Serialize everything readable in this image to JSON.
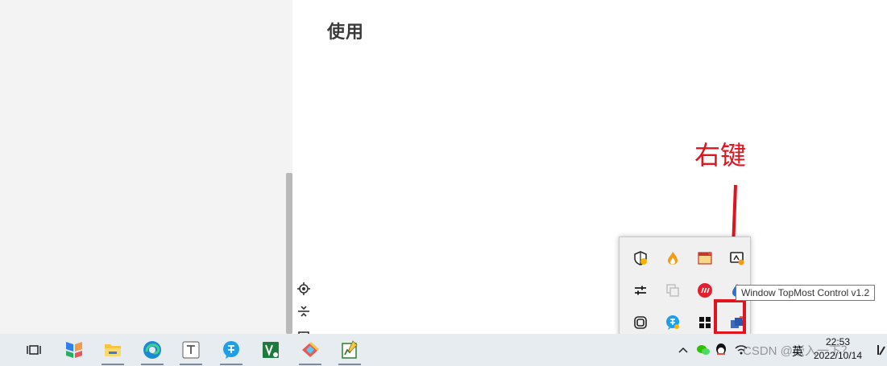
{
  "page": {
    "title": "使用"
  },
  "annotation": {
    "text": "右键",
    "color": "#e0141e"
  },
  "tooltip": {
    "text": "Window TopMost Control v1.2"
  },
  "tray_popup": {
    "icons": [
      "shield-warning-icon",
      "flame-app-icon",
      "window-app-icon",
      "display-app-icon",
      "sliders-icon",
      "copy-app-icon",
      "red-circle-app-icon",
      "blue-drop-app-icon",
      "mesh-app-icon",
      "translate-app-icon",
      "black-squares-app-icon",
      "topmost-control-icon"
    ]
  },
  "taskbar": {
    "apps": [
      "task-view-icon",
      "colorful-app-icon",
      "file-explorer-icon",
      "edge-icon",
      "typora-icon",
      "translate-icon",
      "vs-icon",
      "git-tool-icon",
      "notepad-chart-icon"
    ],
    "tray": {
      "ime": "英",
      "time": "22:53",
      "date": "2022/10/14",
      "watermark": "CSDN @嵌入一下？"
    }
  }
}
